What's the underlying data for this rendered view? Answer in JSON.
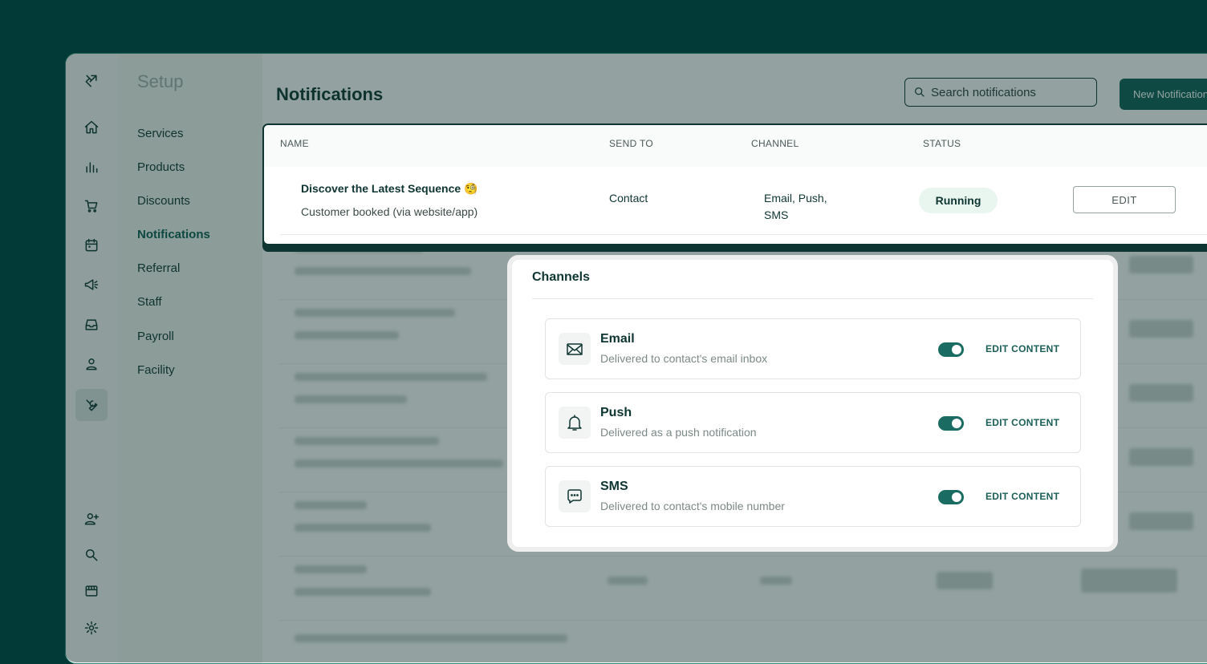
{
  "sidebar": {
    "icons": [
      "logo-icon",
      "home-icon",
      "analytics-icon",
      "cart-icon",
      "calendar-icon",
      "megaphone-icon",
      "inbox-icon",
      "user-icon",
      "wrench-icon",
      "add-user-icon",
      "search-icon",
      "store-icon",
      "settings-icon"
    ]
  },
  "setup": {
    "title": "Setup",
    "items": [
      "Services",
      "Products",
      "Discounts",
      "Notifications",
      "Referral",
      "Staff",
      "Payroll",
      "Facility"
    ],
    "active": "Notifications"
  },
  "header": {
    "title": "Notifications",
    "search_placeholder": "Search notifications",
    "new_button": "New Notification"
  },
  "table": {
    "columns": [
      "NAME",
      "SEND TO",
      "CHANNEL",
      "STATUS"
    ],
    "highlight_row": {
      "title": "Discover the Latest Sequence 🧐",
      "subtitle": "Customer booked (via website/app)",
      "send_to": "Contact",
      "channel_line1": "Email, Push,",
      "channel_line2": "SMS",
      "status": "Running",
      "edit": "EDIT"
    }
  },
  "channels": {
    "title": "Channels",
    "items": [
      {
        "name": "Email",
        "desc": "Delivered to contact's email inbox",
        "enabled": true,
        "action": "EDIT CONTENT",
        "icon": "mail-icon"
      },
      {
        "name": "Push",
        "desc": "Delivered as a push notification",
        "enabled": true,
        "action": "EDIT CONTENT",
        "icon": "bell-icon"
      },
      {
        "name": "SMS",
        "desc": "Delivered to contact's mobile number",
        "enabled": true,
        "action": "EDIT CONTENT",
        "icon": "sms-icon"
      }
    ]
  },
  "colors": {
    "background": "#013a36",
    "accent": "#0d5f56",
    "running_badge": "#e9f5ef"
  }
}
